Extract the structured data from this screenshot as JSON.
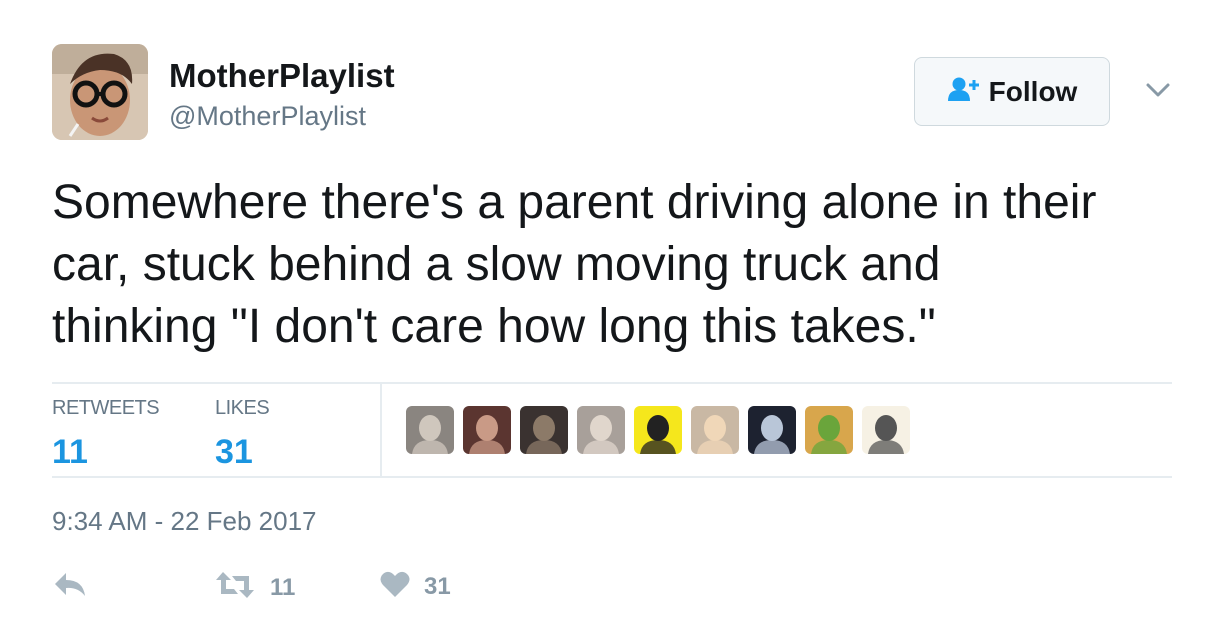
{
  "user": {
    "display_name": "MotherPlaylist",
    "handle": "@MotherPlaylist",
    "avatar_icon": "avatar-photo"
  },
  "follow_button": {
    "label": "Follow",
    "icon": "person-plus-icon"
  },
  "tweet": {
    "lines": [
      "Somewhere there's a parent driving alone in their",
      "car, stuck behind a slow moving truck and",
      "thinking \"I don't care how long this takes.\""
    ]
  },
  "stats": {
    "retweets_label": "RETWEETS",
    "retweets_count": "11",
    "likes_label": "LIKES",
    "likes_count": "31"
  },
  "liker_avatars": [
    {
      "icon": "liker-avatar-1",
      "bg": "#8a8580",
      "fg": "#cfc7bd"
    },
    {
      "icon": "liker-avatar-2",
      "bg": "#5b3530",
      "fg": "#c99a86"
    },
    {
      "icon": "liker-avatar-3",
      "bg": "#3a3230",
      "fg": "#8c7a68"
    },
    {
      "icon": "liker-avatar-4",
      "bg": "#a8a09a",
      "fg": "#e0d6cc"
    },
    {
      "icon": "liker-avatar-5",
      "bg": "#f5e71c",
      "fg": "#222222"
    },
    {
      "icon": "liker-avatar-6",
      "bg": "#c9b8a4",
      "fg": "#f0d7b8"
    },
    {
      "icon": "liker-avatar-7",
      "bg": "#1d2230",
      "fg": "#b9c6d8"
    },
    {
      "icon": "liker-avatar-8",
      "bg": "#d8a64c",
      "fg": "#6aa53b"
    },
    {
      "icon": "liker-avatar-9",
      "bg": "#f6f1e4",
      "fg": "#555555"
    }
  ],
  "timestamp": "9:34 AM - 22 Feb 2017",
  "actions": {
    "reply_icon": "reply-icon",
    "retweet_icon": "retweet-icon",
    "retweet_count": "11",
    "like_icon": "heart-icon",
    "like_count": "31"
  },
  "colors": {
    "accent": "#1b95e0",
    "muted": "#657786",
    "action_gray": "#aab8c2",
    "divider": "#e6ecf0"
  }
}
